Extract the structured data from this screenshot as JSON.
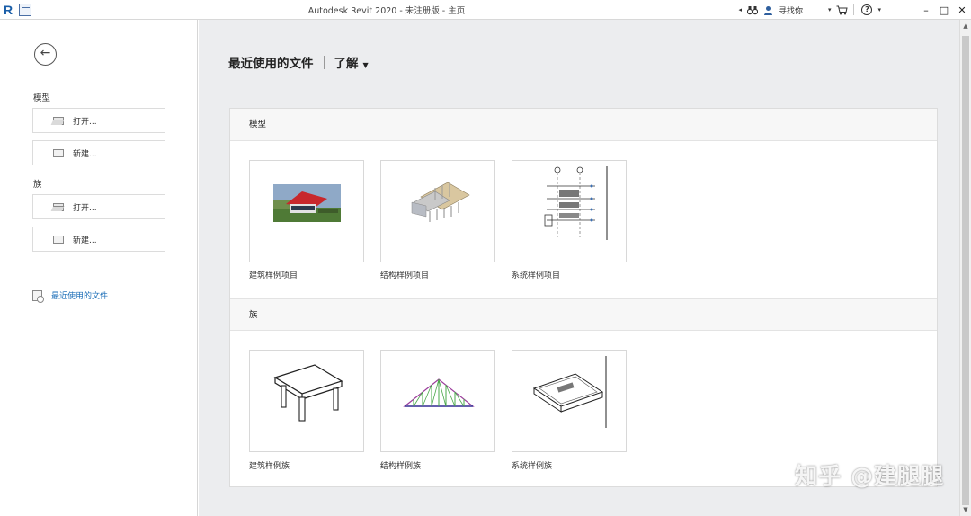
{
  "titlebar": {
    "title": "Autodesk Revit 2020 - 未注册版 - 主页",
    "search_label": "寻找你",
    "help_label": "?"
  },
  "sidebar": {
    "model_section": "模型",
    "model_open": "打开...",
    "model_new": "新建...",
    "family_section": "族",
    "family_open": "打开...",
    "family_new": "新建...",
    "recent_files": "最近使用的文件"
  },
  "main": {
    "tab_recent": "最近使用的文件",
    "tab_learn": "了解",
    "models": {
      "heading": "模型",
      "items": [
        {
          "label": "建筑样例项目"
        },
        {
          "label": "结构样例项目"
        },
        {
          "label": "系统样例项目"
        }
      ]
    },
    "families": {
      "heading": "族",
      "items": [
        {
          "label": "建筑样例族"
        },
        {
          "label": "结构样例族"
        },
        {
          "label": "系统样例族"
        }
      ]
    }
  },
  "watermark": "知乎 @建腿腿",
  "colors": {
    "accent": "#1d6fb8",
    "main_bg": "#ecedef",
    "card_border": "#d8d8d8"
  }
}
